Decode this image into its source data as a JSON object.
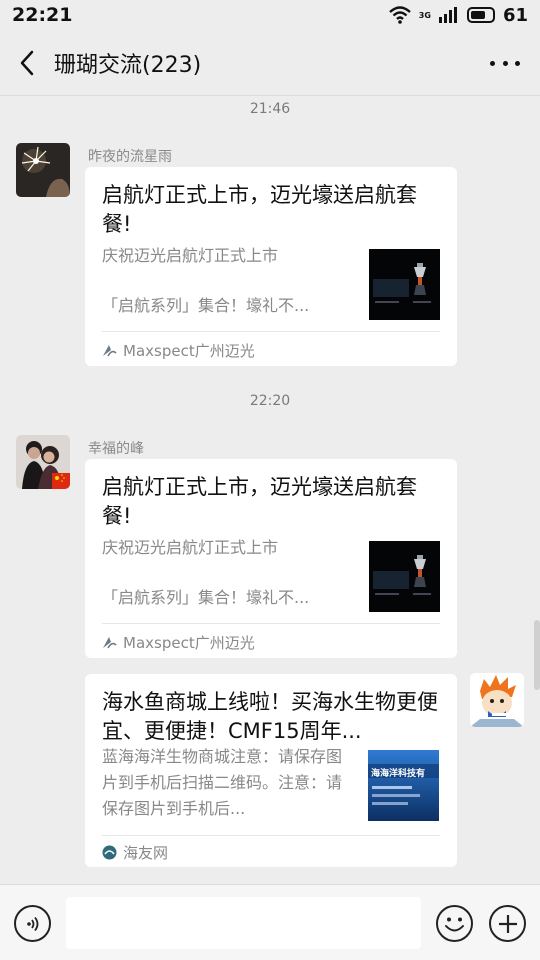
{
  "status_bar": {
    "time": "22:21",
    "network": "3G",
    "battery": "61",
    "battery_level": 0.61
  },
  "header": {
    "title": "珊瑚交流(223)",
    "back_icon": "chevron-left-icon",
    "more_icon": "ellipsis-icon"
  },
  "messages": [
    {
      "timestamp": "21:46",
      "sender": "昨夜的流星雨",
      "card": {
        "title": "启航灯正式上市，迈光壕送启航套餐!",
        "desc": [
          "庆祝迈光启航灯正式上市",
          "「启航系列」集合！壕礼不..."
        ],
        "source": "Maxspect广州迈光"
      }
    },
    {
      "timestamp": "22:20",
      "sender": "幸福的峰",
      "card": {
        "title": "启航灯正式上市，迈光壕送启航套餐!",
        "desc": [
          "庆祝迈光启航灯正式上市",
          "「启航系列」集合！壕礼不..."
        ],
        "source": "Maxspect广州迈光"
      }
    },
    {
      "sender": "",
      "card": {
        "title": "海水鱼商城上线啦！买海水生物更便宜、更便捷！CMF15周年...",
        "desc": [
          "蓝海海洋生物商城注意：请保存图片到手机后扫描二维码。注意：请保存图片到手机后..."
        ],
        "thumb_text": "海海洋科技有",
        "source": "海友网"
      }
    }
  ],
  "colors": {
    "background": "#ededed",
    "card": "#ffffff",
    "muted_text": "#888888",
    "flag_red": "#de2910"
  }
}
